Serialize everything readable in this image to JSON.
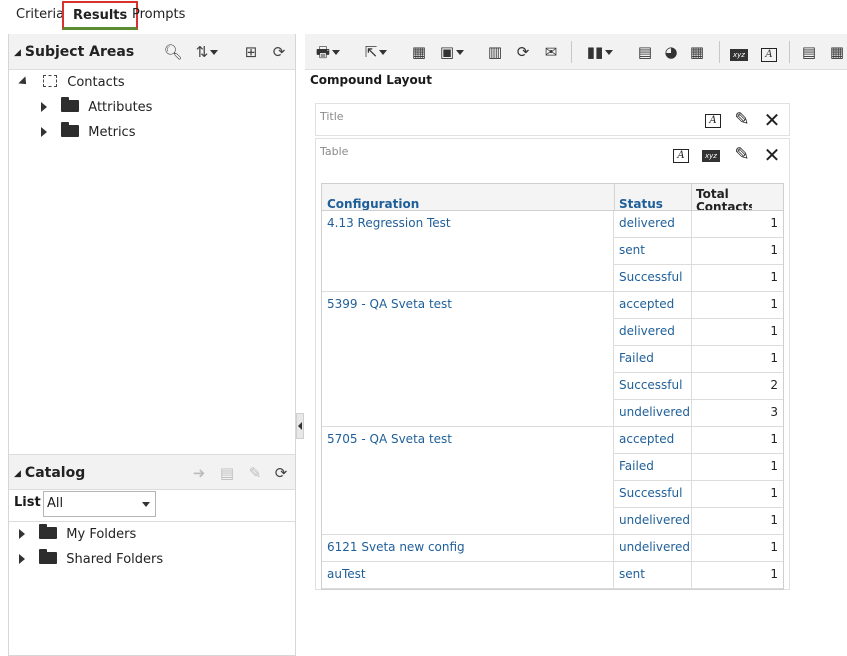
{
  "tabs": [
    {
      "label": "Criteria"
    },
    {
      "label": "Results"
    },
    {
      "label": "Prompts"
    }
  ],
  "subject_areas": {
    "title": "Subject Areas",
    "icons": [
      "search-icon",
      "sort-icon",
      "add-to-layout-icon",
      "refresh-icon"
    ],
    "tree": {
      "root": {
        "label": "Contacts",
        "icon": "subject-area-icon"
      },
      "children": [
        {
          "label": "Attributes",
          "icon": "folder-icon"
        },
        {
          "label": "Metrics",
          "icon": "folder-icon"
        }
      ]
    }
  },
  "catalog": {
    "title": "Catalog",
    "list_label": "List",
    "list_value": "All",
    "icons": [
      "arrow-right-icon",
      "properties-icon",
      "edit-icon",
      "refresh-icon"
    ],
    "folders": [
      {
        "label": "My Folders"
      },
      {
        "label": "Shared Folders"
      }
    ]
  },
  "toolbar": {
    "icons": [
      "print-icon",
      "export-icon",
      "schedule-icon",
      "options-icon",
      "filters-icon",
      "refresh-icon",
      "email-icon",
      "new-view-icon",
      "add-table-icon",
      "add-graph-icon",
      "add-pivot-icon",
      "narrative-icon",
      "title-icon",
      "add-report-icon",
      "more-icon"
    ]
  },
  "layout": {
    "title": "Compound Layout",
    "views": [
      {
        "label": "Title"
      },
      {
        "label": "Table"
      }
    ]
  },
  "table": {
    "headers": {
      "configuration": "Configuration",
      "status": "Status",
      "total": "Total Contacts"
    },
    "groups": [
      {
        "name": "4.13 Regression Test",
        "rows": [
          {
            "status": "delivered",
            "total": "1"
          },
          {
            "status": "sent",
            "total": "1"
          },
          {
            "status": "Successful",
            "total": "1"
          }
        ]
      },
      {
        "name": "5399 - QA Sveta test",
        "rows": [
          {
            "status": "accepted",
            "total": "1"
          },
          {
            "status": "delivered",
            "total": "1"
          },
          {
            "status": "Failed",
            "total": "1"
          },
          {
            "status": "Successful",
            "total": "2"
          },
          {
            "status": "undelivered",
            "total": "3"
          }
        ]
      },
      {
        "name": "5705 - QA Sveta test",
        "rows": [
          {
            "status": "accepted",
            "total": "1"
          },
          {
            "status": "Failed",
            "total": "1"
          },
          {
            "status": "Successful",
            "total": "1"
          },
          {
            "status": "undelivered",
            "total": "1"
          }
        ]
      },
      {
        "name": "6121 Sveta new config",
        "rows": [
          {
            "status": "undelivered",
            "total": "1"
          }
        ]
      },
      {
        "name": "auTest",
        "rows": [
          {
            "status": "sent",
            "total": "1"
          }
        ]
      }
    ]
  }
}
